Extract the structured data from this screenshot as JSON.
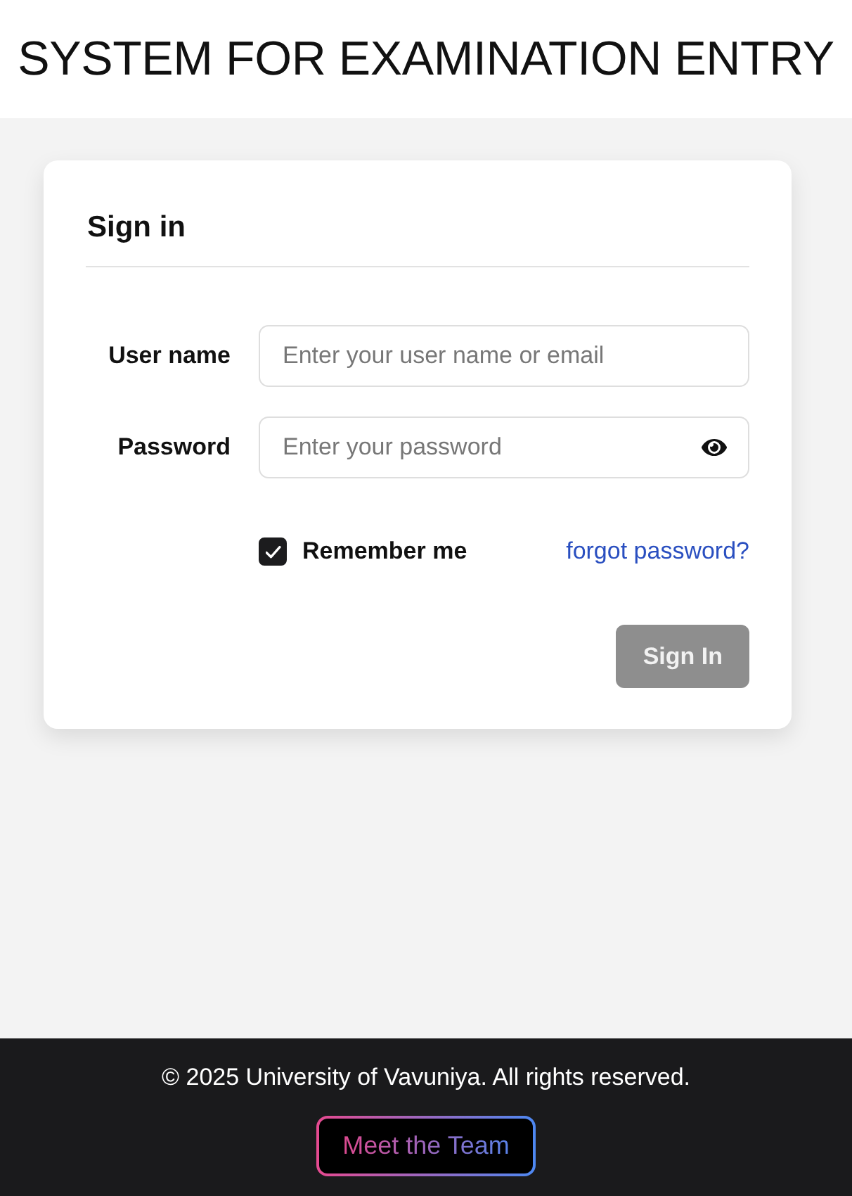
{
  "header": {
    "title": "SYSTEM FOR EXAMINATION ENTRY"
  },
  "sign_in": {
    "title": "Sign in",
    "fields": [
      {
        "label": "User name",
        "placeholder": "Enter your user name or email",
        "kind": "text"
      },
      {
        "label": "Password",
        "placeholder": "Enter your password",
        "kind": "password"
      }
    ],
    "remember_me": {
      "label": "Remember me",
      "checked": true
    },
    "forgot_link": "forgot password?",
    "submit": {
      "label": "Sign In",
      "disabled": true
    }
  },
  "footer": {
    "copyright": "© 2025 University of Vavuniya. All rights reserved.",
    "team_button": "Meet the Team"
  }
}
